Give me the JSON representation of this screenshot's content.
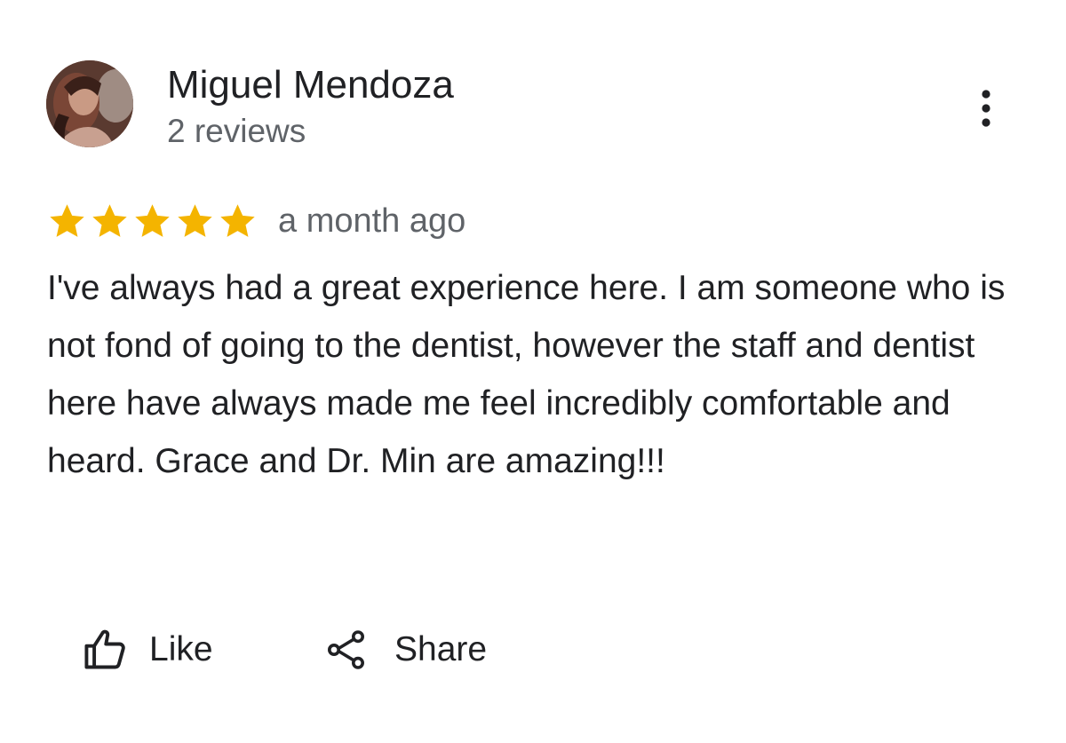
{
  "reviewer": {
    "name": "Miguel Mendoza",
    "review_count": "2 reviews",
    "avatar_icon": "user-photo-avatar"
  },
  "more_menu": {
    "icon": "more-vert-icon"
  },
  "rating": {
    "stars": 5,
    "max_stars": 5,
    "star_color": "#f4b400",
    "date": "a month ago"
  },
  "review": {
    "text": "I've always had a great experience here. I am someone who is not fond of going to the dentist, however the staff and dentist here have always made me feel incredibly comfortable and heard. Grace and Dr. Min are amazing!!!"
  },
  "actions": {
    "like": {
      "label": "Like",
      "icon": "thumb-up-outline-icon"
    },
    "share": {
      "label": "Share",
      "icon": "share-icon"
    }
  }
}
